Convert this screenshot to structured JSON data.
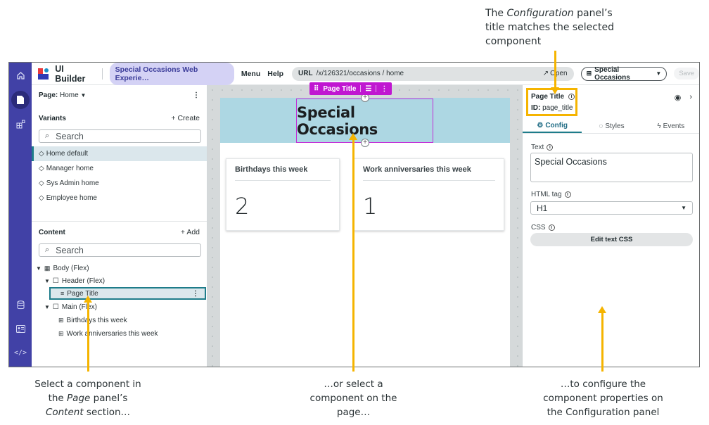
{
  "annotations": {
    "top": {
      "pre": "The ",
      "em": "Configuration",
      "post": " panel’s",
      "line2": "title matches the selected",
      "line3": "component"
    },
    "left": {
      "line1": "Select a component in",
      "line2_pre": "the ",
      "line2_em": "Page",
      "line2_post": " panel’s",
      "line3_em": "Content",
      "line3_post": " section…"
    },
    "middle": {
      "line1": "…or select a",
      "line2": "component on the",
      "line3": "page…"
    },
    "right": {
      "line1": "…to configure the",
      "line2": "component properties on",
      "line3": "the Configuration panel"
    },
    "accent_color": "#f5b400"
  },
  "rail": {
    "icons": [
      "home-icon",
      "page-icon",
      "components-icon",
      "data-icon",
      "form-icon",
      "code-icon"
    ],
    "active": "page-icon"
  },
  "topbar": {
    "app_title": "UI Builder",
    "experience": "Special Occasions Web Experie…",
    "menu": "Menu",
    "help": "Help",
    "url_label": "URL",
    "url_path": "/x/126321/occasions / home",
    "open": "Open",
    "experience_selector": "Special Occasions",
    "save": "Save"
  },
  "page_panel": {
    "page_label": "Page:",
    "page_value": "Home",
    "variants_header": "Variants",
    "create": "+ Create",
    "search_placeholder": "Search",
    "variants": [
      "Home default",
      "Manager home",
      "Sys Admin home",
      "Employee home"
    ],
    "selected_variant": "Home default",
    "content_header": "Content",
    "add": "+ Add",
    "content_search_placeholder": "Search",
    "tree": [
      {
        "label": "Body (Flex)",
        "level": 0,
        "expanded": true
      },
      {
        "label": "Header (Flex)",
        "level": 1,
        "expanded": true
      },
      {
        "label": "Page Title",
        "level": 2,
        "selected": true
      },
      {
        "label": "Main (Flex)",
        "level": 1,
        "expanded": true
      },
      {
        "label": "Birthdays this week",
        "level": 2
      },
      {
        "label": "Work anniversaries this week",
        "level": 2
      }
    ]
  },
  "canvas": {
    "toolbar_label": "Page Title",
    "hero_title": "Special Occasions",
    "hero_color": "#add7e3",
    "selection_color": "#c016d1",
    "cards": [
      {
        "title": "Birthdays this week",
        "value": "2"
      },
      {
        "title": "Work anniversaries this week",
        "value": "1"
      }
    ]
  },
  "config": {
    "title": "Page Title",
    "id_label": "ID:",
    "id_value": "page_title",
    "tabs": [
      "Config",
      "Styles",
      "Events"
    ],
    "active_tab": "Config",
    "text_label": "Text",
    "text_value": "Special Occasions",
    "html_tag_label": "HTML tag",
    "html_tag_value": "H1",
    "css_label": "CSS",
    "css_button": "Edit text CSS"
  }
}
